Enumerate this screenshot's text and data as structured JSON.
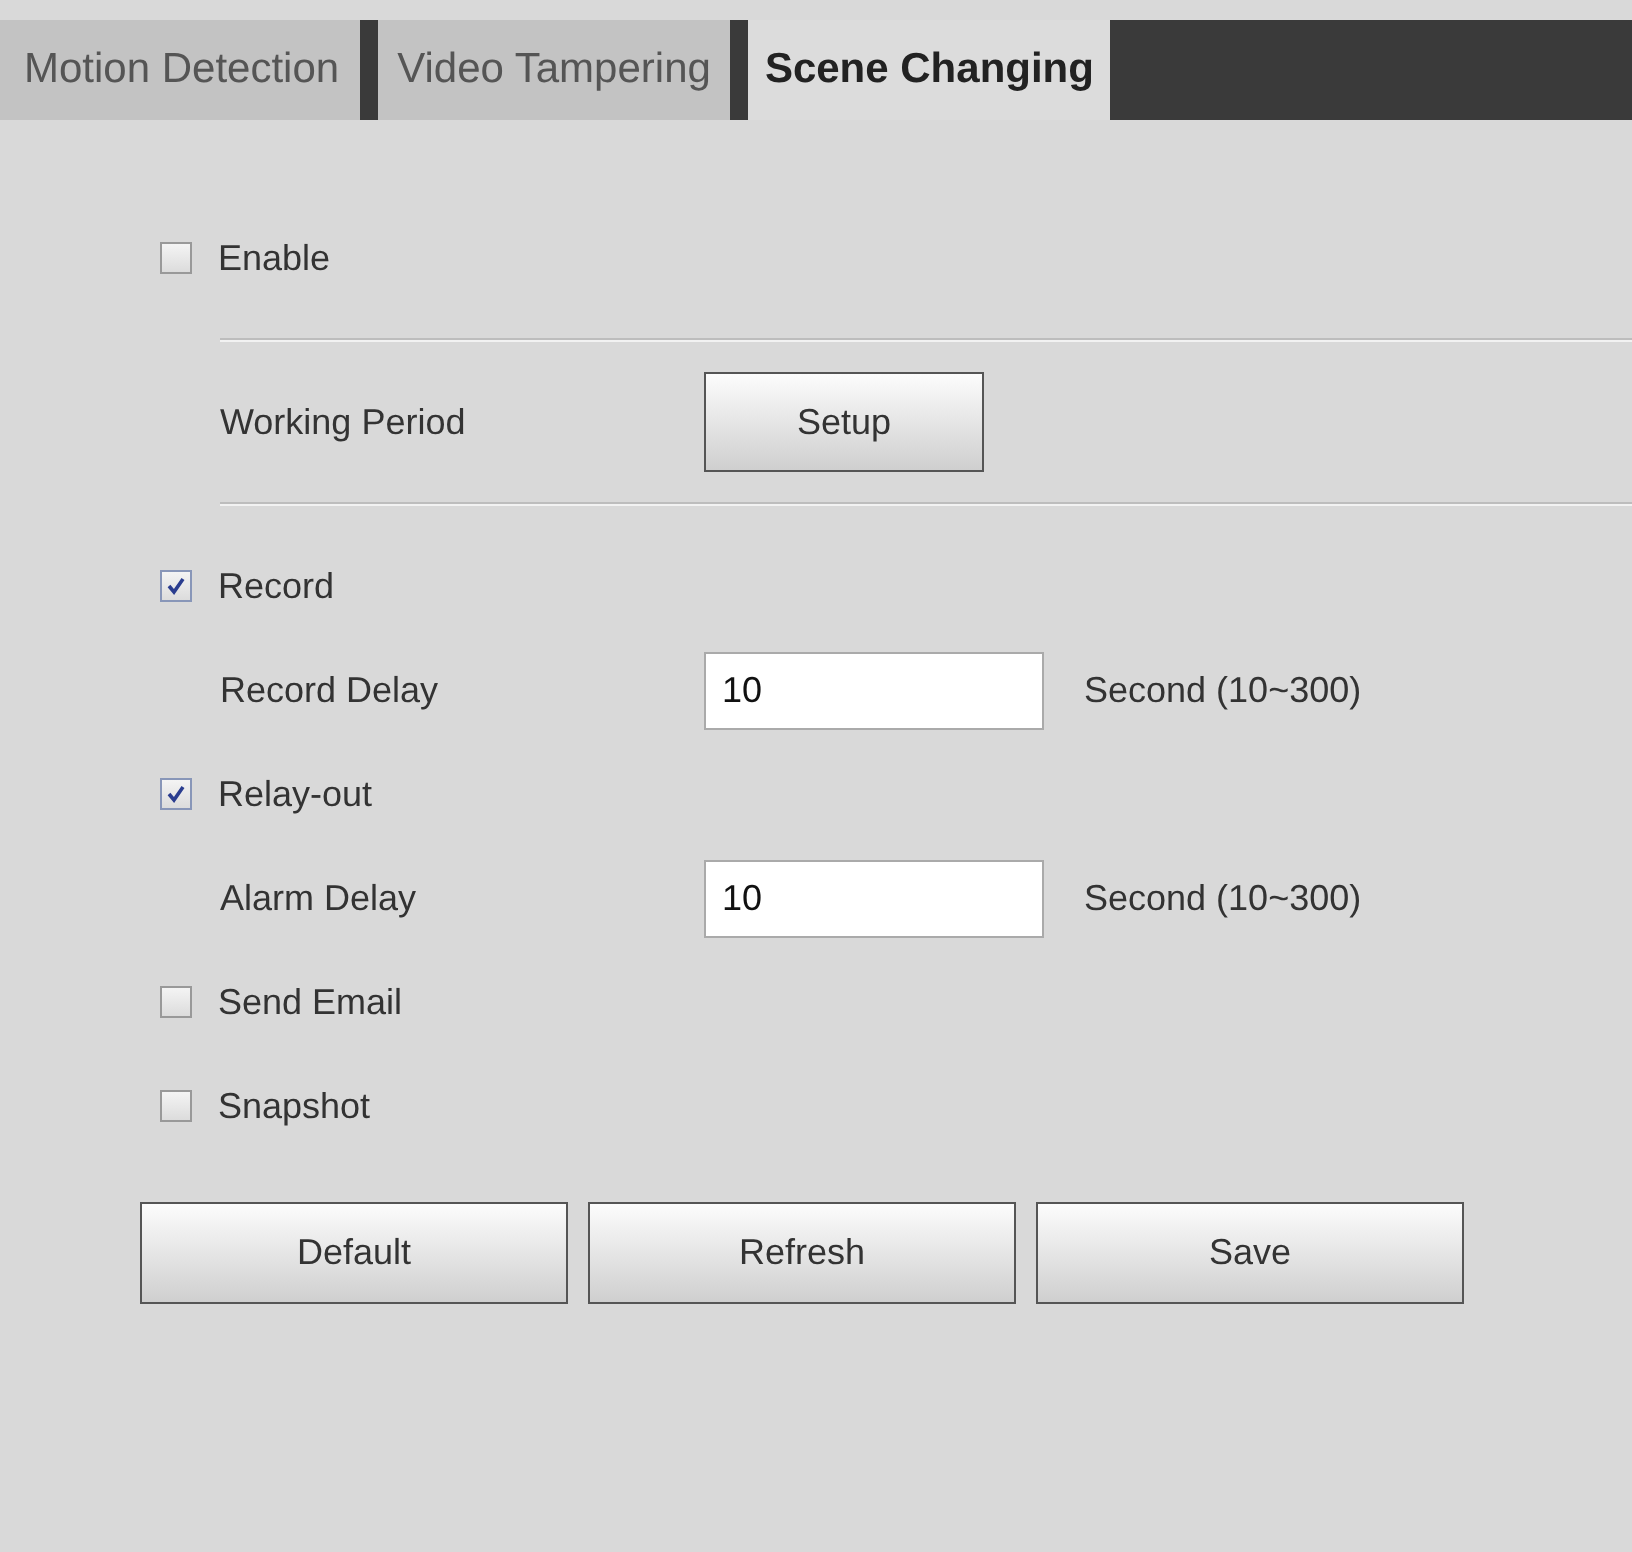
{
  "tabs": [
    {
      "label": "Motion Detection",
      "selected": false
    },
    {
      "label": "Video Tampering",
      "selected": false
    },
    {
      "label": "Scene Changing",
      "selected": true
    }
  ],
  "settings": [
    {
      "kind": "checkbox",
      "label": "Enable",
      "checked": false
    },
    {
      "kind": "divider"
    },
    {
      "kind": "button",
      "label": "Working Period",
      "button": "Setup"
    },
    {
      "kind": "divider"
    },
    {
      "kind": "checkbox",
      "label": "Record",
      "checked": true
    },
    {
      "kind": "input",
      "label": "Record Delay",
      "value": "10",
      "unit": "Second (10~300)"
    },
    {
      "kind": "checkbox",
      "label": "Relay-out",
      "checked": true
    },
    {
      "kind": "input",
      "label": "Alarm Delay",
      "value": "10",
      "unit": "Second (10~300)"
    },
    {
      "kind": "checkbox",
      "label": "Send Email",
      "checked": false
    },
    {
      "kind": "checkbox",
      "label": "Snapshot",
      "checked": false
    }
  ],
  "buttons": [
    "Default",
    "Refresh",
    "Save"
  ]
}
